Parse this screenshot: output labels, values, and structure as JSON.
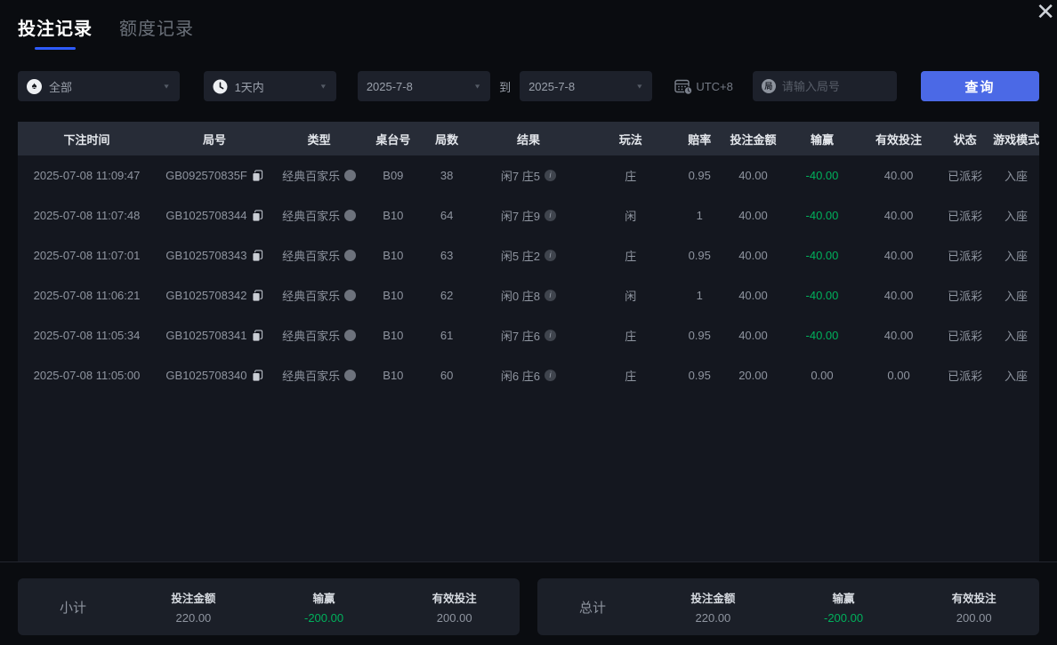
{
  "icons": {
    "close": "✕",
    "caret": "▼",
    "spade": "♠",
    "round_badge": "局",
    "info": "i"
  },
  "tabs": [
    {
      "label": "投注记录"
    },
    {
      "label": "额度记录"
    }
  ],
  "filters": {
    "game_type": "全部",
    "time_range": "1天内",
    "date_from": "2025-7-8",
    "to_label": "到",
    "date_to": "2025-7-8",
    "timezone": "UTC+8",
    "round_placeholder": "请输入局号",
    "search_button": "查询"
  },
  "table": {
    "columns": [
      "下注时间",
      "局号",
      "类型",
      "桌台号",
      "局数",
      "结果",
      "玩法",
      "赔率",
      "投注金额",
      "输赢",
      "有效投注",
      "状态",
      "游戏模式"
    ],
    "rows": [
      {
        "time": "2025-07-08 11:09:47",
        "round_id": "GB092570835F",
        "type": "经典百家乐",
        "table_no": "B09",
        "round_no": "38",
        "result": "闲7 庄5",
        "play": "庄",
        "odds": "0.95",
        "bet": "40.00",
        "win_loss": "-40.00",
        "valid_bet": "40.00",
        "status": "已派彩",
        "mode": "入座"
      },
      {
        "time": "2025-07-08 11:07:48",
        "round_id": "GB1025708344",
        "type": "经典百家乐",
        "table_no": "B10",
        "round_no": "64",
        "result": "闲7 庄9",
        "play": "闲",
        "odds": "1",
        "bet": "40.00",
        "win_loss": "-40.00",
        "valid_bet": "40.00",
        "status": "已派彩",
        "mode": "入座"
      },
      {
        "time": "2025-07-08 11:07:01",
        "round_id": "GB1025708343",
        "type": "经典百家乐",
        "table_no": "B10",
        "round_no": "63",
        "result": "闲5 庄2",
        "play": "庄",
        "odds": "0.95",
        "bet": "40.00",
        "win_loss": "-40.00",
        "valid_bet": "40.00",
        "status": "已派彩",
        "mode": "入座"
      },
      {
        "time": "2025-07-08 11:06:21",
        "round_id": "GB1025708342",
        "type": "经典百家乐",
        "table_no": "B10",
        "round_no": "62",
        "result": "闲0 庄8",
        "play": "闲",
        "odds": "1",
        "bet": "40.00",
        "win_loss": "-40.00",
        "valid_bet": "40.00",
        "status": "已派彩",
        "mode": "入座"
      },
      {
        "time": "2025-07-08 11:05:34",
        "round_id": "GB1025708341",
        "type": "经典百家乐",
        "table_no": "B10",
        "round_no": "61",
        "result": "闲7 庄6",
        "play": "庄",
        "odds": "0.95",
        "bet": "40.00",
        "win_loss": "-40.00",
        "valid_bet": "40.00",
        "status": "已派彩",
        "mode": "入座"
      },
      {
        "time": "2025-07-08 11:05:00",
        "round_id": "GB1025708340",
        "type": "经典百家乐",
        "table_no": "B10",
        "round_no": "60",
        "result": "闲6 庄6",
        "play": "庄",
        "odds": "0.95",
        "bet": "20.00",
        "win_loss": "0.00",
        "valid_bet": "0.00",
        "status": "已派彩",
        "mode": "入座"
      }
    ]
  },
  "summary": {
    "subtotal": {
      "label": "小计",
      "bet_label": "投注金额",
      "bet_value": "220.00",
      "winloss_label": "输赢",
      "winloss_value": "-200.00",
      "valid_label": "有效投注",
      "valid_value": "200.00"
    },
    "total": {
      "label": "总计",
      "bet_label": "投注金额",
      "bet_value": "220.00",
      "winloss_label": "输赢",
      "winloss_value": "-200.00",
      "valid_label": "有效投注",
      "valid_value": "200.00"
    }
  },
  "colors": {
    "accent_blue": "#4b69e6",
    "tab_underline": "#2e5bff",
    "loss_green": "#00b15c"
  }
}
